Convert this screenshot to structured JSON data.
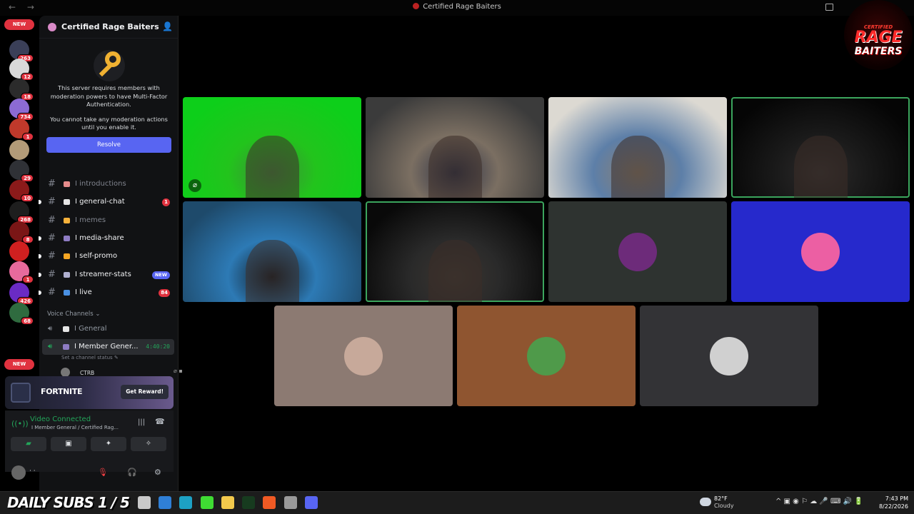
{
  "window": {
    "title": "Certified Rage Baiters",
    "nav": "← →"
  },
  "logo": {
    "line1": "CERTIFIED",
    "line2": "RAGE",
    "line3": "BAITERS"
  },
  "guilds": {
    "new_top": "NEW",
    "new_bottom": "NEW",
    "items": [
      {
        "count": "263",
        "color": "#3a3f58"
      },
      {
        "count": "12",
        "color": "#d9d9d9"
      },
      {
        "count": "18",
        "color": "#2b2b2b"
      },
      {
        "count": "734",
        "color": "#8c6bd3"
      },
      {
        "count": "1",
        "color": "#c0392b"
      },
      {
        "count": "",
        "color": "#b39b78"
      },
      {
        "count": "29",
        "color": "#2f3136"
      },
      {
        "count": "10",
        "color": "#8b1a1a"
      },
      {
        "count": "268",
        "color": "#1e1e1e"
      },
      {
        "count": "8",
        "color": "#7a1616"
      },
      {
        "count": "",
        "color": "#d02020"
      },
      {
        "count": "1",
        "color": "#e76a9c"
      },
      {
        "count": "426",
        "color": "#6a2bc4"
      },
      {
        "count": "68",
        "color": "#2f6b3f"
      }
    ]
  },
  "server": {
    "name": "Certified Rage Baiters"
  },
  "mfa": {
    "line1": "This server requires members with moderation powers to have Multi-Factor Authentication.",
    "line2": "You cannot take any moderation actions until you enable it.",
    "button": "Resolve"
  },
  "channels": [
    {
      "name": "I introductions",
      "emoji_color": "#e58c8c",
      "state": "muted",
      "badge": "",
      "new": ""
    },
    {
      "name": "I general-chat",
      "emoji_color": "#e6e6e6",
      "state": "unread",
      "badge": "1",
      "new": ""
    },
    {
      "name": "I memes",
      "emoji_color": "#f7b23b",
      "state": "muted",
      "badge": "",
      "new": ""
    },
    {
      "name": "I media-share",
      "emoji_color": "#8e7cc3",
      "state": "unread",
      "badge": "",
      "new": ""
    },
    {
      "name": "I self-promo",
      "emoji_color": "#f5a623",
      "state": "unread",
      "badge": "",
      "new": ""
    },
    {
      "name": "I streamer-stats",
      "emoji_color": "#b0b0d0",
      "state": "unread",
      "badge": "",
      "new": "NEW"
    },
    {
      "name": "I live",
      "emoji_color": "#4a90e2",
      "state": "unread",
      "badge": "84",
      "new": ""
    }
  ],
  "voice": {
    "header": "Voice Channels ⌄",
    "general": {
      "name": "I General",
      "emoji_color": "#e6e6e6"
    },
    "active": {
      "name": "I Member Gener...",
      "emoji_color": "#8e7cc3",
      "timer": "4:40:20"
    },
    "channel_status": "Set a channel status ✎",
    "member": "CTRB"
  },
  "promo": {
    "game": "FORTNITE",
    "button": "Get Reward!"
  },
  "rtc": {
    "status": "Video Connected",
    "location": "I Member General / Certified Rag...",
    "signal_icon": "((•))",
    "waves_icon": "|||",
    "hangup_icon": "☎",
    "buttons": {
      "camera": "▰",
      "screen": "▣",
      "activity": "✦",
      "soundboard": "✧"
    }
  },
  "user": {
    "name": "·  ·",
    "mic_icon": "🎙",
    "headset_icon": "🎧",
    "settings_icon": "⚙"
  },
  "tiles": [
    {
      "id": "tile-1",
      "kind": "video",
      "colors": [
        "#0dcf1a",
        "#22c41c",
        "#3f8a3a"
      ],
      "speaking": false,
      "muted": true
    },
    {
      "id": "tile-2",
      "kind": "video",
      "colors": [
        "#3b3b3b",
        "#7b6f62",
        "#2a2f44"
      ],
      "speaking": false,
      "muted": false
    },
    {
      "id": "tile-3",
      "kind": "video",
      "colors": [
        "#dcd9d2",
        "#5d7fa8",
        "#8d8070"
      ],
      "speaking": false,
      "muted": false
    },
    {
      "id": "tile-4",
      "kind": "video",
      "colors": [
        "#050505",
        "#1a1a1a",
        "#2d2b2b"
      ],
      "speaking": true,
      "muted": false
    },
    {
      "id": "tile-5",
      "kind": "video",
      "colors": [
        "#1e4a6b",
        "#2d7ab5",
        "#101820"
      ],
      "speaking": false,
      "muted": false
    },
    {
      "id": "tile-6",
      "kind": "video",
      "colors": [
        "#090909",
        "#2a2a2a",
        "#3a3530"
      ],
      "speaking": true,
      "muted": false
    },
    {
      "id": "tile-7",
      "kind": "avatar",
      "bg": "#2e3330",
      "avatar": "#6d2b7a"
    },
    {
      "id": "tile-8",
      "kind": "avatar",
      "bg": "#2629cc",
      "avatar": "#ec5fa3"
    },
    {
      "id": "tile-9",
      "kind": "avatar",
      "bg": "#8c7a72",
      "avatar": "#c7a99a"
    },
    {
      "id": "tile-10",
      "kind": "avatar",
      "bg": "#8f5530",
      "avatar": "#4f9a4a"
    },
    {
      "id": "tile-11",
      "kind": "avatar",
      "bg": "#333336",
      "avatar": "#d0d0d0"
    }
  ],
  "taskbar": {
    "overlay": "DAILY SUBS 1 / 5",
    "apps": [
      {
        "name": "file-explorer",
        "color": "#c9c9c9"
      },
      {
        "name": "vscode",
        "color": "#2f7fd6"
      },
      {
        "name": "edge",
        "color": "#1da1c4"
      },
      {
        "name": "kick",
        "color": "#3fdc33"
      },
      {
        "name": "folder",
        "color": "#f2c94c"
      },
      {
        "name": "terminal",
        "color": "#173b1f"
      },
      {
        "name": "brave",
        "color": "#f05a24"
      },
      {
        "name": "obs",
        "color": "#9a9a9a"
      },
      {
        "name": "discord",
        "color": "#5865f2"
      }
    ],
    "weather": {
      "temp": "82°F",
      "desc": "Cloudy"
    },
    "tray": "^   ▣  ◉  ⚐  ☁  🎤  ⌨  🔊  🔋",
    "time": "7:43 PM",
    "date": "8/22/2026"
  }
}
